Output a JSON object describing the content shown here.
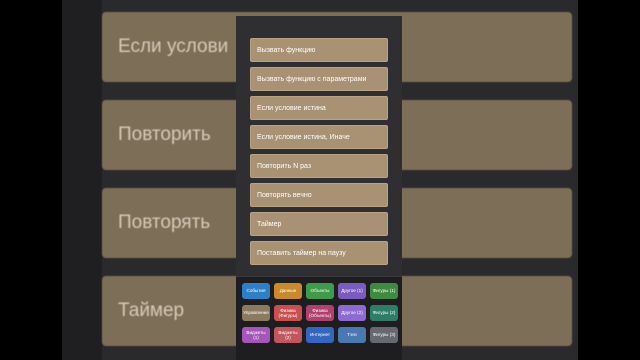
{
  "background_cards": [
    "Если услови",
    "Повторить",
    "Повторять",
    "Таймер"
  ],
  "blocks": [
    "Вызвать функцию",
    "Вызвать функцию с параметрами",
    "Если условие истина",
    "Если условие истина, Иначе",
    "Повторить N раз",
    "Повторять вечно",
    "Таймер",
    "Поставить таймер на паузу"
  ],
  "categories": [
    {
      "label": "События",
      "color": "#2f7fc4"
    },
    {
      "label": "Данные",
      "color": "#c98a2e"
    },
    {
      "label": "Объекты",
      "color": "#3f9a4a"
    },
    {
      "label": "Другое (1)",
      "color": "#7a5bbf"
    },
    {
      "label": "Фигуры (1)",
      "color": "#3e8a3e"
    },
    {
      "label": "Управление",
      "color": "#8c7a5e"
    },
    {
      "label": "Физика (Фигуры)",
      "color": "#c9504f"
    },
    {
      "label": "Физика (Объекты)",
      "color": "#b0416e"
    },
    {
      "label": "Другое (2)",
      "color": "#8d6bd0"
    },
    {
      "label": "Фигуры (2)",
      "color": "#2e7d67"
    },
    {
      "label": "Виджеты (1)",
      "color": "#a556b8"
    },
    {
      "label": "Виджеты (2)",
      "color": "#c2565e"
    },
    {
      "label": "Интернет",
      "color": "#3466c0"
    },
    {
      "label": "Тэги",
      "color": "#4a78b0"
    },
    {
      "label": "Фигуры (3)",
      "color": "#666a70"
    }
  ]
}
